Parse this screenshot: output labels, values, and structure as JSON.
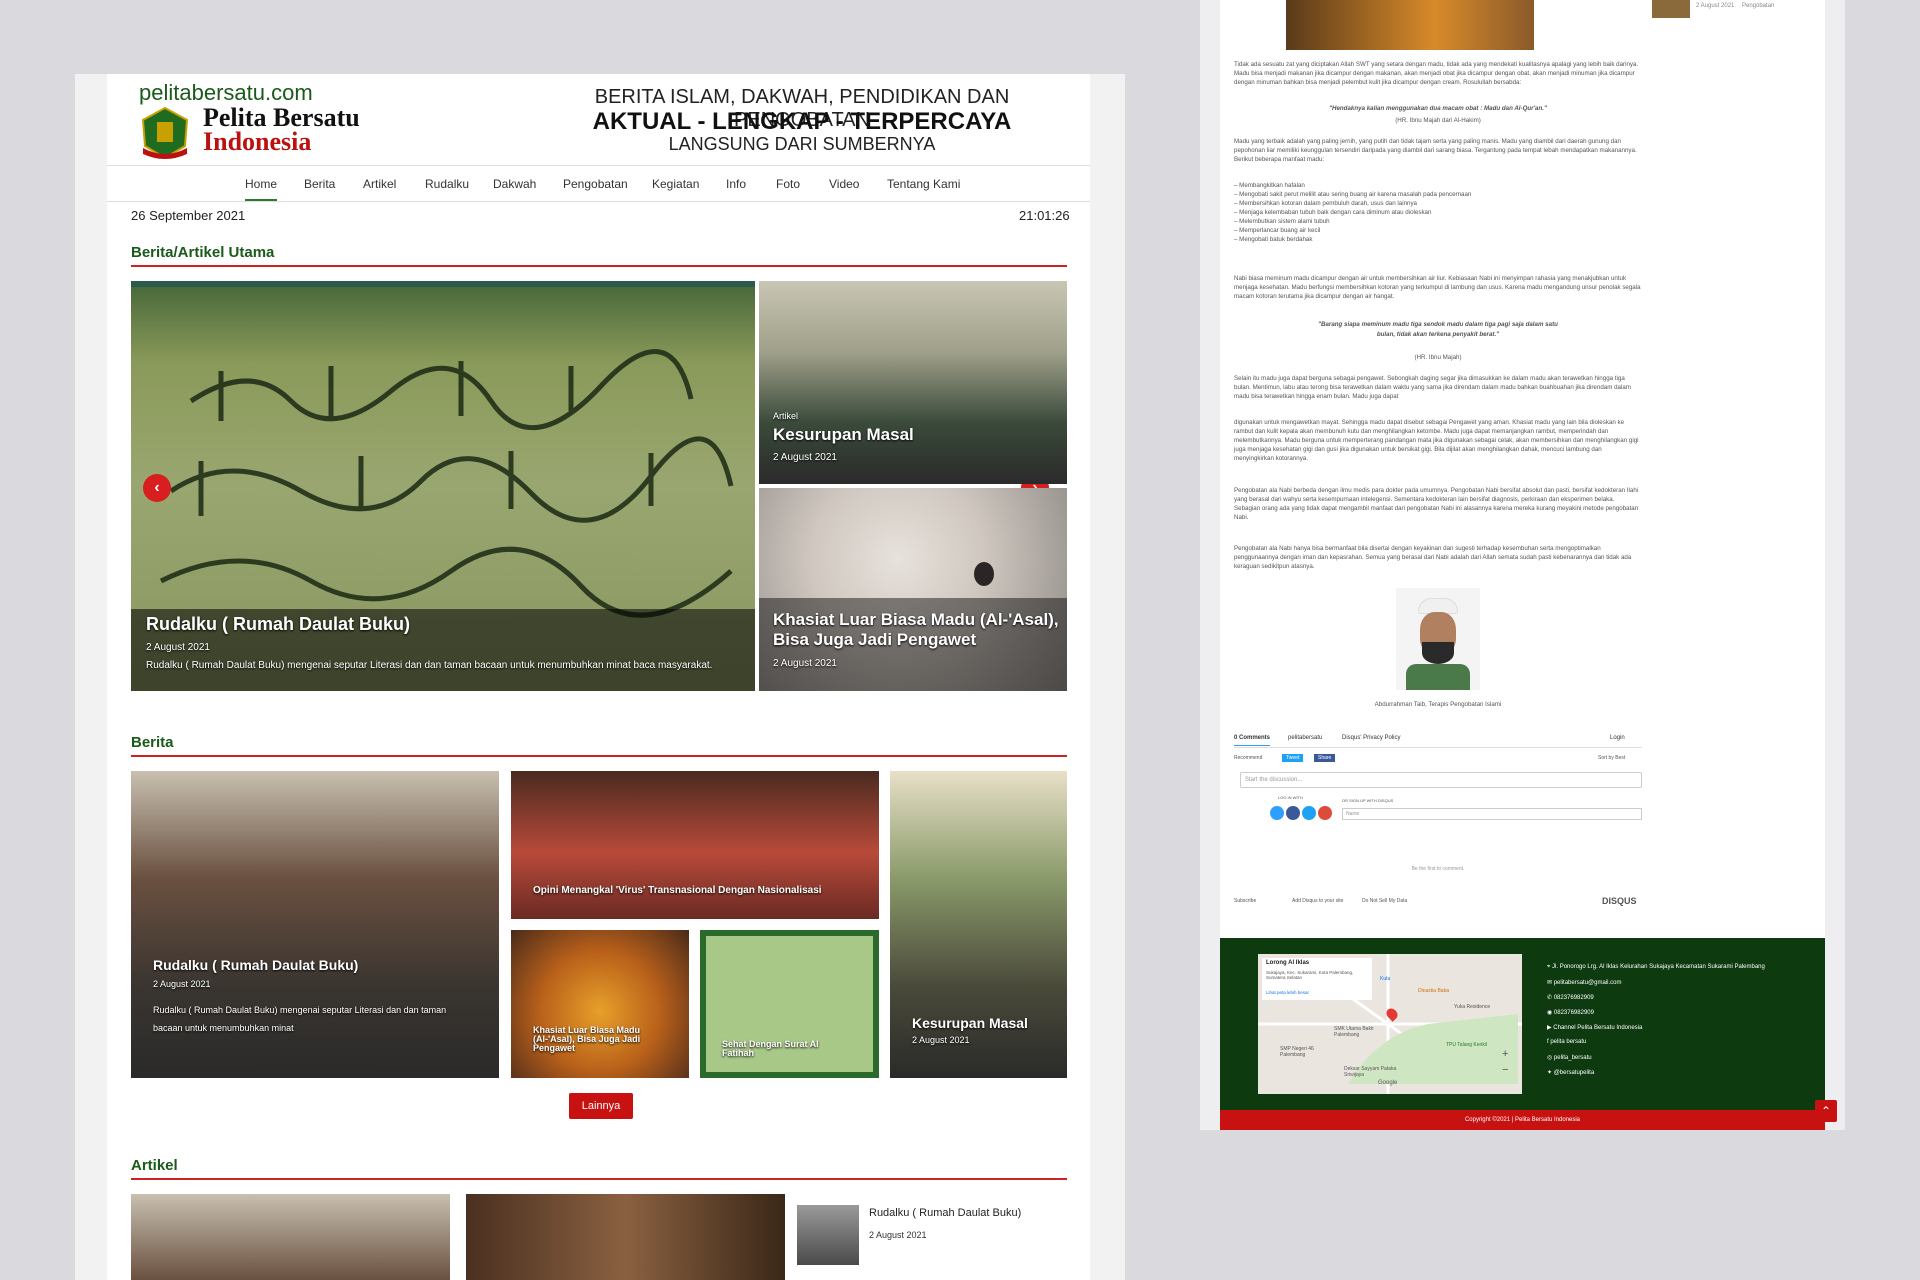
{
  "site": {
    "domain": "pelitabersatu.com",
    "logo_line1": "Pelita Bersatu",
    "logo_line2": "Indonesia",
    "tagline1": "BERITA ISLAM, DAKWAH, PENDIDIKAN DAN PENGOBATAN",
    "tagline2": "AKTUAL - LENGKAP - TERPERCAYA",
    "tagline3": "LANGSUNG DARI SUMBERNYA"
  },
  "nav": [
    "Home",
    "Berita",
    "Artikel",
    "Rudalku",
    "Dakwah",
    "Pengobatan",
    "Kegiatan",
    "Info",
    "Foto",
    "Video",
    "Tentang Kami"
  ],
  "date": "26 September 2021",
  "time": "21:01:26",
  "utama": {
    "title": "Berita/Artikel Utama",
    "main": {
      "title": "Rudalku ( Rumah Daulat Buku)",
      "date": "2 August 2021",
      "excerpt": "Rudalku ( Rumah Daulat Buku) mengenai seputar Literasi dan dan taman bacaan untuk menumbuhkan minat baca masyarakat."
    },
    "side1": {
      "category": "Artikel",
      "title": "Kesurupan Masal",
      "date": "2 August 2021"
    },
    "side2": {
      "title_l1": "Khasiat Luar Biasa Madu (Al-'Asal),",
      "title_l2": "Bisa Juga Jadi Pengawet",
      "date": "2 August 2021"
    }
  },
  "berita": {
    "title": "Berita",
    "big": {
      "title": "Rudalku ( Rumah Daulat Buku)",
      "date": "2 August 2021",
      "excerpt_l1": "Rudalku ( Rumah Daulat Buku) mengenai seputar Literasi dan dan taman",
      "excerpt_l2": "bacaan untuk menumbuhkan minat"
    },
    "opini": "Opini Menangkal 'Virus' Transnasional Dengan Nasionalisasi",
    "madu_l1": "Khasiat Luar Biasa Madu",
    "madu_l2": "(Al-'Asal), Bisa Juga Jadi",
    "madu_l3": "Pengawet",
    "sehat_l1": "Sehat Dengan Surat Al",
    "sehat_l2": "Fatihah",
    "kesurupan": {
      "title": "Kesurupan Masal",
      "date": "2 August 2021"
    },
    "more": "Lainnya"
  },
  "artikel": {
    "title": "Artikel",
    "list_title": "Rudalku ( Rumah Daulat Buku)",
    "list_date": "2 August 2021"
  },
  "right": {
    "top_date": "2 August 2021",
    "top_cat": "Pengobatan",
    "paras": [
      "Tidak ada sesuatu zat yang diciptakan Allah SWT yang setara dengan madu, tidak ada yang mendekati kualitasnya apalagi yang lebih baik darinya. Madu bisa menjadi makanan jika dicampur dengan makanan, akan menjadi obat jika dicampur dengan obat, akan menjadi minuman jika dicampur dengan minuman bahkan bisa menjadi pelembut kulit jika dicampur dengan cream. Rosulullah bersabda:",
      "Madu yang terbaik adalah yang paling jernih, yang putih dan tidak tajam serta yang paling manis. Madu yang diambil dari daerah gunung dan pepohonan liar memiliki keunggulan tersendiri daripada yang diambil dari sarang biasa. Tergantung pada tempat lebah mendapatkan makanannya. Berikut beberapa manfaat madu:",
      "Nabi biasa meminum madu dicampur dengan air untuk membersihkan air liur. Kebiasaan Nabi ini menyimpan rahasia yang menakjubkan untuk menjaga kesehatan. Madu berfungsi membersihkan kotoran yang terkumpul di lambung dan usus. Karena madu mengandung unsur penolak segala macam kotoran terutama jika dicampur dengan air hangat.",
      "Selain itu madu juga dapat berguna sebagai pengawet. Sebongkah daging segar jika dimasukkan ke dalam madu akan terawetkan hingga tiga bulan. Mentimun, labu atau terong bisa terawetkan dalam waktu yang sama jika direndam dalam madu bahkan buahbuahan jika direndam dalam madu bisa terawetkan hingga enam bulan. Madu juga dapat",
      "digunakan untuk mengawetkan mayat. Sehingga madu dapat disebut sebagai Pengawet yang aman. Khasiat madu yang lain bila dioleskan ke rambut dan kulit kepala akan membunuh kutu dan menghilangkan ketombe. Madu juga dapat memanjangkan rambut, memperindah dan melembutkannya. Madu berguna untuk memperterang pandangan mata jika digunakan sebagai celak, akan membersihkan dan menghilangkan gigi juga menjaga kesehatan gigi dan gusi jika digunakan untuk bersikat gigi. Bila dijilat akan menghilangkan dahak, mencuci lambung dan menyingkirkan kotorannya.",
      "Pengobatan ala Nabi berbeda dengan ilmu medis para dokter pada umumnya. Pengobatan Nabi bersifat absolut dan pasti, bersifat kedokteran Ilahi yang berasal dari wahyu serta kesempurnaan intelegensi. Sementara kedokteran lain bersifat diagnosis, perkiraan dan eksperimen belaka. Sebagian orang ada yang tidak dapat mengambil manfaat dari pengobatan Nabi ini alasannya karena mereka kurang meyakini metode pengobatan Nabi.",
      "Pengobatan ala Nabi hanya bisa bermanfaat bila disertai dengan keyakinan dan sugesti terhadap kesembuhan serta mengoptimalkan penggunaannya dengan iman dan kepasrahan. Semua yang berasal dari Nabi adalah dari Allah semata sudah pasti kebenarannya dan tidak ada keraguan sedikitpun atasnya."
    ],
    "quote1": "\"Hendaknya kalian menggunakan dua macam obat : Madu dan Al-Qur'an.\"",
    "quote1_src": "(HR. Ibnu Majah dari Al-Hakim)",
    "benefits": [
      "– Membangkitkan hafalan",
      "– Mengobati sakit perut melilit atau sering buang air karena masalah pada pencernaan",
      "– Membersihkan kotoran dalam pembuluh darah, usus dan lainnya",
      "– Menjaga kelembaban tubuh baik dengan cara diminum atau dioleskan",
      "– Melembutkan sistem alami tubuh",
      "– Memperlancar buang air kecil",
      "– Mengobati batuk berdahak"
    ],
    "quote2_l1": "\"Barang siapa meminum madu tiga sendok madu dalam tiga pagi saja dalam satu",
    "quote2_l2": "bulan, tidak akan terkena penyakit berat.\"",
    "quote2_src": "(HR. Ibnu Majah)",
    "author_caption": "Abdurrahman Taib, Terapis Pengobatan Islami",
    "disqus": {
      "comments": "0 Comments",
      "site": "pelitabersatu",
      "privacy": "Disqus' Privacy Policy",
      "login": "Login",
      "recommend": "Recommend",
      "tweet": "Tweet",
      "share": "Share",
      "sort": "Sort by Best",
      "placeholder": "Start the discussion...",
      "login_with": "LOG IN WITH",
      "or_signup": "OR SIGN UP WITH DISQUS",
      "name_ph": "Name",
      "first": "Be the first to comment.",
      "subscribe": "Subscribe",
      "add": "Add Disqus to your site",
      "dnsmpi": "Do Not Sell My Data",
      "brand": "DISQUS"
    },
    "map": {
      "place": "Lorong Al Iklas",
      "addr": "Sukajaya, Kec. Sukarami, Kota Palembang, Sumatera Selatan",
      "link": "Lihat peta lebih besar",
      "poi1": "Kuta",
      "poi2": "Dinastia Baba",
      "poi3": "Yuka Residence",
      "poi4": "SMK Utama Bakti Palembang",
      "poi5": "SMP Negeri 46 Palembang",
      "poi6": "TPU Talang Kerikil",
      "poi7": "Deksar Sayyam Pataka Sriwijaya",
      "google": "Google"
    },
    "contacts": [
      "Jl. Ponorogo Lrg. Al Iklas Kelurahan Sukajaya Kecamatan Sukarami Palembang",
      "pelitabersatu@gmail.com",
      "082376982909",
      "082376982909",
      "Channel Pelita Bersatu Indonesia",
      "pelita bersatu",
      "pelita_bersatu",
      "@bersatupelita"
    ],
    "copyright": "Copyright ©2021 | Pelita Bersatu Indonesia"
  }
}
